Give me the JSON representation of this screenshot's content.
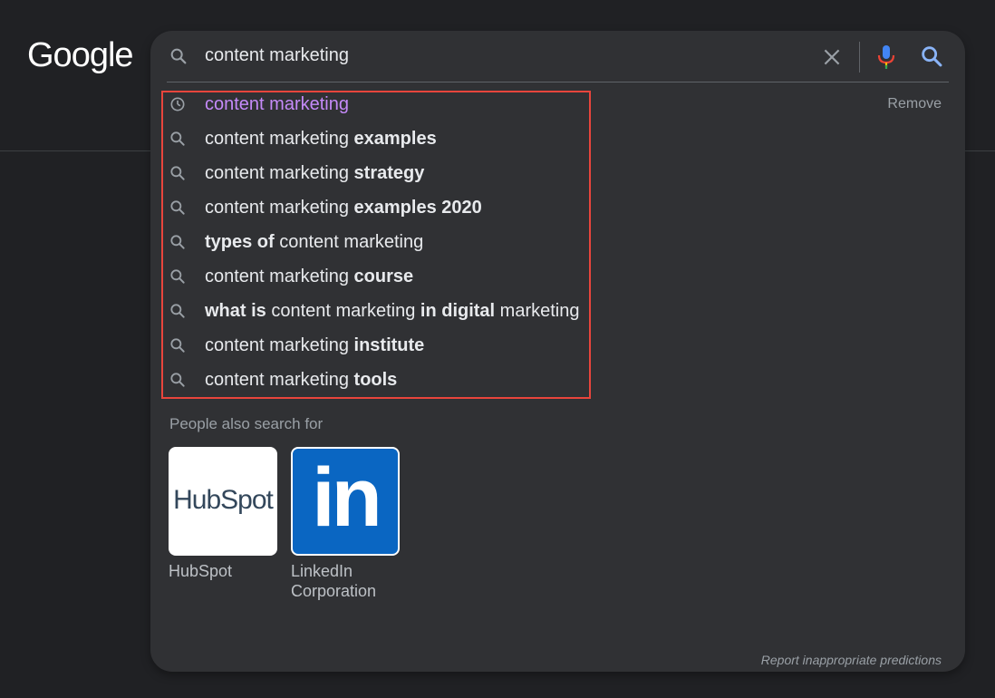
{
  "logo": {
    "text": "Google"
  },
  "search": {
    "query": "content marketing",
    "icons": {
      "lead": "search-icon",
      "clear": "close-icon",
      "mic": "mic-icon",
      "submit": "search-icon"
    }
  },
  "suggestions": [
    {
      "type": "history",
      "icon": "history-icon",
      "parts": [
        {
          "t": "content marketing",
          "b": false
        }
      ],
      "remove_label": "Remove"
    },
    {
      "type": "search",
      "icon": "search-icon",
      "parts": [
        {
          "t": "content marketing ",
          "b": false
        },
        {
          "t": "examples",
          "b": true
        }
      ]
    },
    {
      "type": "search",
      "icon": "search-icon",
      "parts": [
        {
          "t": "content marketing ",
          "b": false
        },
        {
          "t": "strategy",
          "b": true
        }
      ]
    },
    {
      "type": "search",
      "icon": "search-icon",
      "parts": [
        {
          "t": "content marketing ",
          "b": false
        },
        {
          "t": "examples 2020",
          "b": true
        }
      ]
    },
    {
      "type": "search",
      "icon": "search-icon",
      "parts": [
        {
          "t": "types of",
          "b": true
        },
        {
          "t": " content marketing",
          "b": false
        }
      ]
    },
    {
      "type": "search",
      "icon": "search-icon",
      "parts": [
        {
          "t": "content marketing ",
          "b": false
        },
        {
          "t": "course",
          "b": true
        }
      ]
    },
    {
      "type": "search",
      "icon": "search-icon",
      "parts": [
        {
          "t": "what is",
          "b": true
        },
        {
          "t": " content marketing ",
          "b": false
        },
        {
          "t": "in digital",
          "b": true
        },
        {
          "t": " marketing",
          "b": false
        }
      ]
    },
    {
      "type": "search",
      "icon": "search-icon",
      "parts": [
        {
          "t": "content marketing ",
          "b": false
        },
        {
          "t": "institute",
          "b": true
        }
      ]
    },
    {
      "type": "search",
      "icon": "search-icon",
      "parts": [
        {
          "t": "content marketing ",
          "b": false
        },
        {
          "t": "tools",
          "b": true
        }
      ]
    }
  ],
  "people_also_search": {
    "title": "People also search for",
    "items": [
      {
        "name": "HubSpot",
        "logo_text": "HubSpot",
        "logo_color": "#33475b",
        "accent": "#ff7a59"
      },
      {
        "name": "LinkedIn Corporation",
        "logo_text": "in",
        "logo_color": "#0a66c2"
      }
    ]
  },
  "footer": {
    "report_label": "Report inappropriate predictions"
  },
  "colors": {
    "background": "#202124",
    "panel": "#303134",
    "history_text": "#c58af9",
    "highlight_border": "#e8453c"
  }
}
